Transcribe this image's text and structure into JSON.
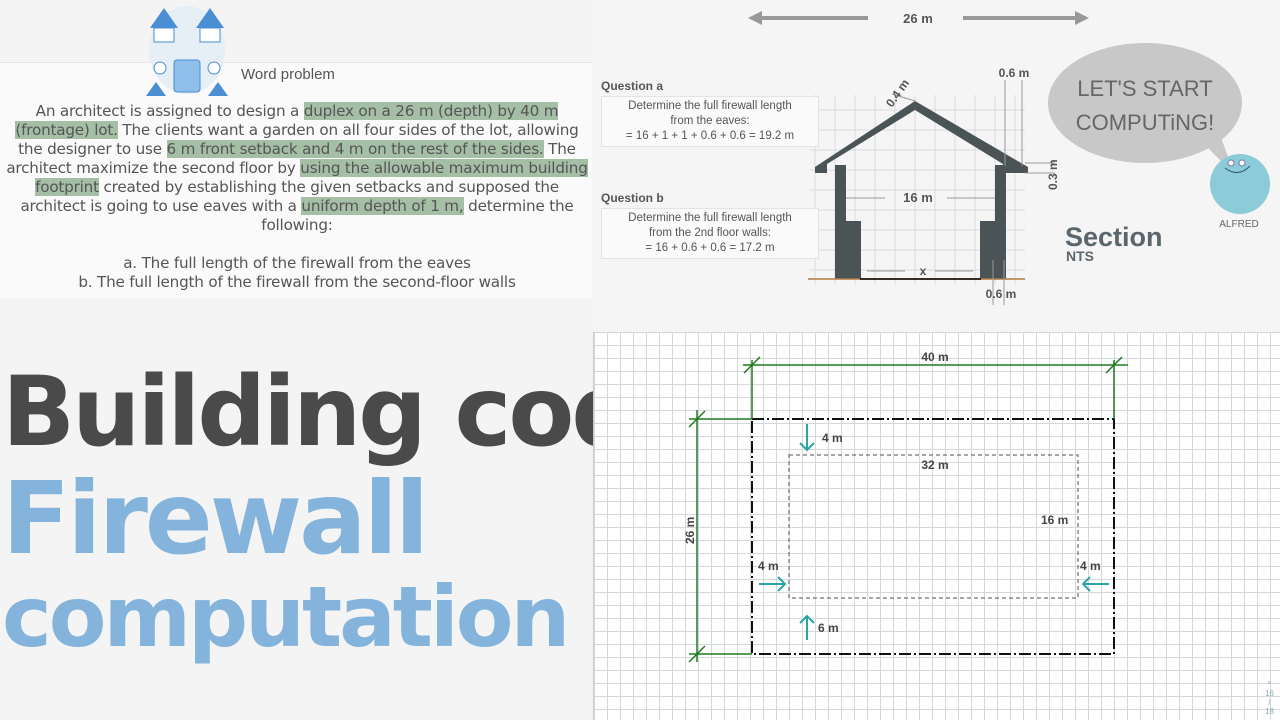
{
  "word_problem": {
    "title": "Word problem",
    "p1": "An architect is assigned to design a ",
    "h1": "duplex on a 26 m (depth) by 40 m (frontage) lot.",
    "p2": " The clients want a garden on all four sides of the lot, allowing the designer to use ",
    "h2": "6 m front setback and 4 m on the rest of the sides.",
    "p3": " The architect maximize the second floor by ",
    "h3": "using the allowable maximum building footprint",
    "p4": " created by establishing the given setbacks and supposed the architect is going to use eaves with a ",
    "h4": "uniform depth of 1 m,",
    "p5": " determine the following:",
    "item_a": "a. The full length of the firewall from the eaves",
    "item_b": "b. The full length of the firewall from the second-floor walls",
    "highlight_color": "#a5bea6"
  },
  "section": {
    "depth_label": "26 m",
    "question_a": {
      "label": "Question a",
      "l1": "Determine the full firewall length",
      "l2": "from the eaves:",
      "l3": "= 16 + 1 + 1 + 0.6 + 0.6 = 19.2 m"
    },
    "question_b": {
      "label": "Question b",
      "l1": "Determine the full firewall length",
      "l2": "from the 2nd floor walls:",
      "l3": "= 16 + 0.6 + 0.6 = 17.2 m"
    },
    "dim_04": "0.4 m",
    "dim_06_top": "0.6 m",
    "dim_03": "0.3 m",
    "dim_16": "16 m",
    "dim_x": "x",
    "dim_06_bottom": "0.6 m",
    "title": "Section",
    "subtitle": "NTS",
    "bubble_l1": "LET'S START",
    "bubble_l2": "COMPUTiNG!",
    "mascot_name": "ALFRED"
  },
  "headline": {
    "line1": "Building code:",
    "line2": "Firewall",
    "line3": "computation",
    "dark_color": "#4a4a4a",
    "accent_color": "#84b4dc"
  },
  "plan": {
    "width": "40 m",
    "depth": "26 m",
    "setback_top": "4 m",
    "footprint_width": "32 m",
    "footprint_depth": "16 m",
    "setback_left": "4 m",
    "setback_right": "4 m",
    "setback_front": "6 m",
    "dim_color": "#1f7a1f",
    "arrow_color": "#2aa5a5"
  },
  "pager": {
    "current": "16",
    "sep": "/",
    "total": "18"
  }
}
